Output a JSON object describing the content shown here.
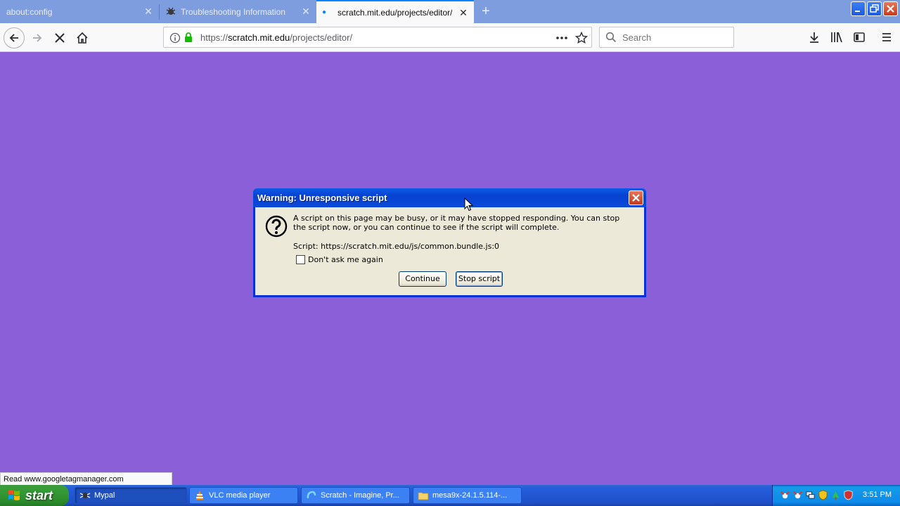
{
  "browser": {
    "tabs": [
      {
        "title": "about:config",
        "active": false
      },
      {
        "title": "Troubleshooting Information",
        "active": false
      },
      {
        "title": "scratch.mit.edu/projects/editor/",
        "active": true
      }
    ],
    "url": {
      "prefix": "https://",
      "host": "scratch.mit.edu",
      "path": "/projects/editor/"
    },
    "search_placeholder": "Search",
    "status_text": "Read www.googletagmanager.com"
  },
  "dialog": {
    "title": "Warning: Unresponsive script",
    "message": "A script on this page may be busy, or it may have stopped responding. You can stop the script now, or you can continue to see if the script will complete.",
    "script_line": "Script: https://scratch.mit.edu/js/common.bundle.js:0",
    "checkbox_label": "Don't ask me again",
    "checkbox_checked": false,
    "continue_label": "Continue",
    "stop_label": "Stop script"
  },
  "taskbar": {
    "start_label": "start",
    "tasks": [
      {
        "label": "Mypal",
        "icon": "mypal-icon",
        "active": true
      },
      {
        "label": "VLC media player",
        "icon": "vlc-icon",
        "active": false
      },
      {
        "label": "Scratch - Imagine, Pr...",
        "icon": "scratch-icon",
        "active": false
      },
      {
        "label": "mesa9x-24.1.5.114-...",
        "icon": "folder-icon",
        "active": false
      }
    ],
    "clock": "3:51 PM"
  },
  "colors": {
    "page_background": "#8a5fd8",
    "xp_title_blue": "#0842d2",
    "start_green": "#379d37",
    "taskbar_blue": "#245edb"
  }
}
